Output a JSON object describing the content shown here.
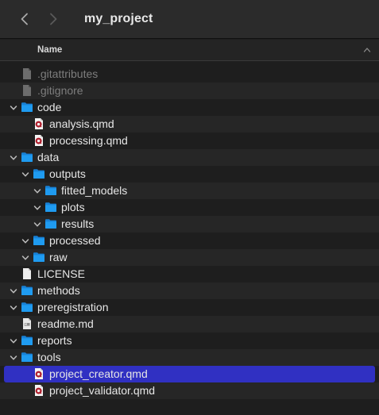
{
  "window": {
    "title": "my_project",
    "column_header": "Name"
  },
  "colors": {
    "folder": "#1f9bf0",
    "selection": "#3030c2",
    "background": "#1e1e1e"
  },
  "items": [
    {
      "name": ".gitattributes",
      "kind": "file",
      "depth": 0,
      "dim": true,
      "icon": "generic-file-icon"
    },
    {
      "name": ".gitignore",
      "kind": "file",
      "depth": 0,
      "dim": true,
      "icon": "generic-file-icon"
    },
    {
      "name": "code",
      "kind": "folder",
      "depth": 0,
      "expanded": true,
      "icon": "folder-icon"
    },
    {
      "name": "analysis.qmd",
      "kind": "file",
      "depth": 1,
      "icon": "quarto-file-icon"
    },
    {
      "name": "processing.qmd",
      "kind": "file",
      "depth": 1,
      "icon": "quarto-file-icon"
    },
    {
      "name": "data",
      "kind": "folder",
      "depth": 0,
      "expanded": true,
      "icon": "folder-icon"
    },
    {
      "name": "outputs",
      "kind": "folder",
      "depth": 1,
      "expanded": true,
      "icon": "folder-icon"
    },
    {
      "name": "fitted_models",
      "kind": "folder",
      "depth": 2,
      "expanded": true,
      "icon": "folder-icon"
    },
    {
      "name": "plots",
      "kind": "folder",
      "depth": 2,
      "expanded": true,
      "icon": "folder-icon"
    },
    {
      "name": "results",
      "kind": "folder",
      "depth": 2,
      "expanded": true,
      "icon": "folder-icon"
    },
    {
      "name": "processed",
      "kind": "folder",
      "depth": 1,
      "expanded": true,
      "icon": "folder-icon"
    },
    {
      "name": "raw",
      "kind": "folder",
      "depth": 1,
      "expanded": true,
      "icon": "folder-icon"
    },
    {
      "name": "LICENSE",
      "kind": "file",
      "depth": 0,
      "icon": "text-file-icon"
    },
    {
      "name": "methods",
      "kind": "folder",
      "depth": 0,
      "expanded": true,
      "icon": "folder-icon"
    },
    {
      "name": "preregistration",
      "kind": "folder",
      "depth": 0,
      "expanded": true,
      "icon": "folder-icon"
    },
    {
      "name": "readme.md",
      "kind": "file",
      "depth": 0,
      "icon": "markdown-file-icon"
    },
    {
      "name": "reports",
      "kind": "folder",
      "depth": 0,
      "expanded": true,
      "icon": "folder-icon"
    },
    {
      "name": "tools",
      "kind": "folder",
      "depth": 0,
      "expanded": true,
      "icon": "folder-icon"
    },
    {
      "name": "project_creator.qmd",
      "kind": "file",
      "depth": 1,
      "selected": true,
      "icon": "quarto-file-icon"
    },
    {
      "name": "project_validator.qmd",
      "kind": "file",
      "depth": 1,
      "icon": "quarto-file-icon"
    }
  ]
}
